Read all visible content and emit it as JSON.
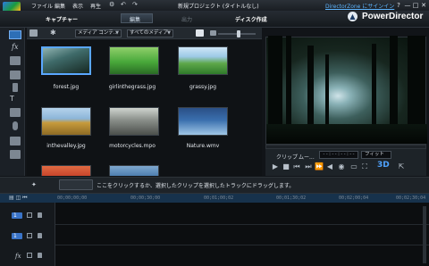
{
  "menu": [
    "ファイル",
    "編集",
    "表示",
    "再生",
    "編集"
  ],
  "project_title": "新規プロジェクト (タイトルなし)",
  "directorzone_link": "DirectorZone にサインイン",
  "window_buttons": [
    "?",
    "—",
    "□",
    "✕"
  ],
  "modes": {
    "capture": "キャプチャー",
    "edit": "編集",
    "output": "出力",
    "disc": "ディスク作成"
  },
  "brand": "PowerDirector",
  "library": {
    "media_type_combo": "メディア コンテ...",
    "filter_combo": "すべてのメディア",
    "items": [
      {
        "caption": "forest.jpg",
        "thumb_color": "#3f6b6a",
        "selected": true
      },
      {
        "caption": "girlinthegrass.jpg",
        "thumb_color": "#48a83a",
        "selected": false
      },
      {
        "caption": "grassy.jpg",
        "thumb_color": "#5ea84a",
        "selected": false
      },
      {
        "caption": "inthevalley.jpg",
        "thumb_color": "#c79b3c",
        "selected": false
      },
      {
        "caption": "motorcycles.mpo",
        "thumb_color": "#8a8f8a",
        "selected": false
      },
      {
        "caption": "Nature.wmv",
        "thumb_color": "#3a6fae",
        "selected": false
      },
      {
        "caption": "",
        "thumb_color": "#c8452c",
        "selected": false
      },
      {
        "caption": "",
        "thumb_color": "#4e7fb0",
        "selected": false
      }
    ]
  },
  "preview": {
    "clip_label": "クリップ",
    "movie_label": "ムー...",
    "timecode": "--:--:--:--",
    "fit_label": "フィット",
    "btn_3d": "3D"
  },
  "hint": "ここをクリックするか、選択したクリップを選択したトラックにドラッグします。",
  "ruler_ticks": [
    "00;00;00;00",
    "00;00;30;00",
    "00;01;00;02",
    "00;01;30;02",
    "00;02;00;04",
    "00;02;30;04"
  ],
  "tracks": [
    "1",
    "1",
    "fx"
  ],
  "icons": {
    "logo": "powerdirector-logo-icon",
    "settings": "gear-icon",
    "search": "search-icon"
  }
}
